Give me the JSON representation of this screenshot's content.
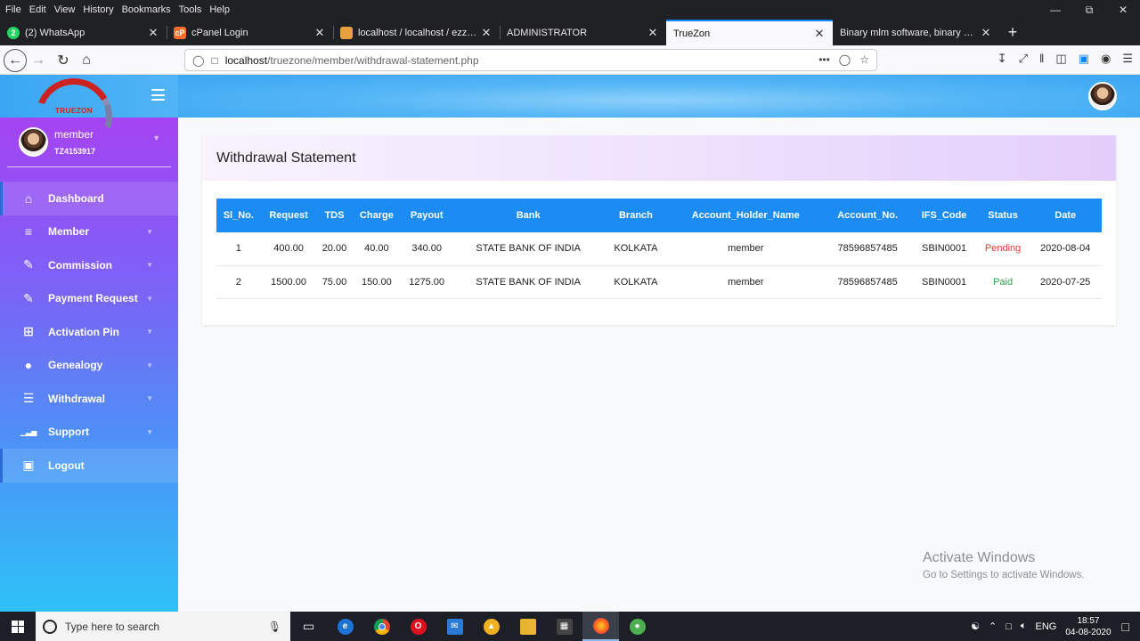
{
  "browser": {
    "menus": [
      "File",
      "Edit",
      "View",
      "History",
      "Bookmarks",
      "Tools",
      "Help"
    ],
    "tabs": [
      {
        "title": "(2) WhatsApp",
        "fav_color": "#25d366",
        "fav_char": "2"
      },
      {
        "title": "cPanel Login",
        "fav_color": "#ff6c2c",
        "fav_char": "cP"
      },
      {
        "title": "localhost / localhost / ezzyeam",
        "fav_color": "#e8a040",
        "fav_char": ""
      },
      {
        "title": "ADMINISTRATOR",
        "fav_color": "",
        "fav_char": ""
      },
      {
        "title": "TrueZon",
        "fav_color": "",
        "fav_char": ""
      },
      {
        "title": "Binary mlm software, binary mlm so",
        "fav_color": "",
        "fav_char": ""
      }
    ],
    "url_host": "localhost",
    "url_path": "/truezone/member/withdrawal-statement.php"
  },
  "sidebar": {
    "logo_text": "TRUEZON",
    "user_name": "member",
    "user_id": "TZ4153917",
    "items": [
      {
        "label": "Dashboard",
        "icon": "home-icon"
      },
      {
        "label": "Member",
        "icon": "layers-icon"
      },
      {
        "label": "Commission",
        "icon": "edit-icon"
      },
      {
        "label": "Payment Request",
        "icon": "edit-icon"
      },
      {
        "label": "Activation Pin",
        "icon": "grid-icon"
      },
      {
        "label": "Genealogy",
        "icon": "user-icon"
      },
      {
        "label": "Withdrawal",
        "icon": "list-icon"
      },
      {
        "label": "Support",
        "icon": "bar-chart-icon"
      },
      {
        "label": "Logout",
        "icon": "lock-icon"
      }
    ]
  },
  "page": {
    "title": "Withdrawal Statement",
    "columns": [
      "Sl_No.",
      "Request",
      "TDS",
      "Charge",
      "Payout",
      "Bank",
      "Branch",
      "Account_Holder_Name",
      "Account_No.",
      "IFS_Code",
      "Status",
      "Date"
    ],
    "rows": [
      [
        "1",
        "400.00",
        "20.00",
        "40.00",
        "340.00",
        "STATE BANK OF INDIA",
        "KOLKATA",
        "member",
        "78596857485",
        "SBIN0001",
        "Pending",
        "2020-08-04"
      ],
      [
        "2",
        "1500.00",
        "75.00",
        "150.00",
        "1275.00",
        "STATE BANK OF INDIA",
        "KOLKATA",
        "member",
        "78596857485",
        "SBIN0001",
        "Paid",
        "2020-07-25"
      ]
    ],
    "status_colors": {
      "Pending": "#e53935",
      "Paid": "#2ea44f"
    }
  },
  "watermark": {
    "line1": "Activate Windows",
    "line2": "Go to Settings to activate Windows."
  },
  "taskbar": {
    "search_placeholder": "Type here to search",
    "lang": "ENG",
    "time": "18:57",
    "date": "04-08-2020"
  }
}
